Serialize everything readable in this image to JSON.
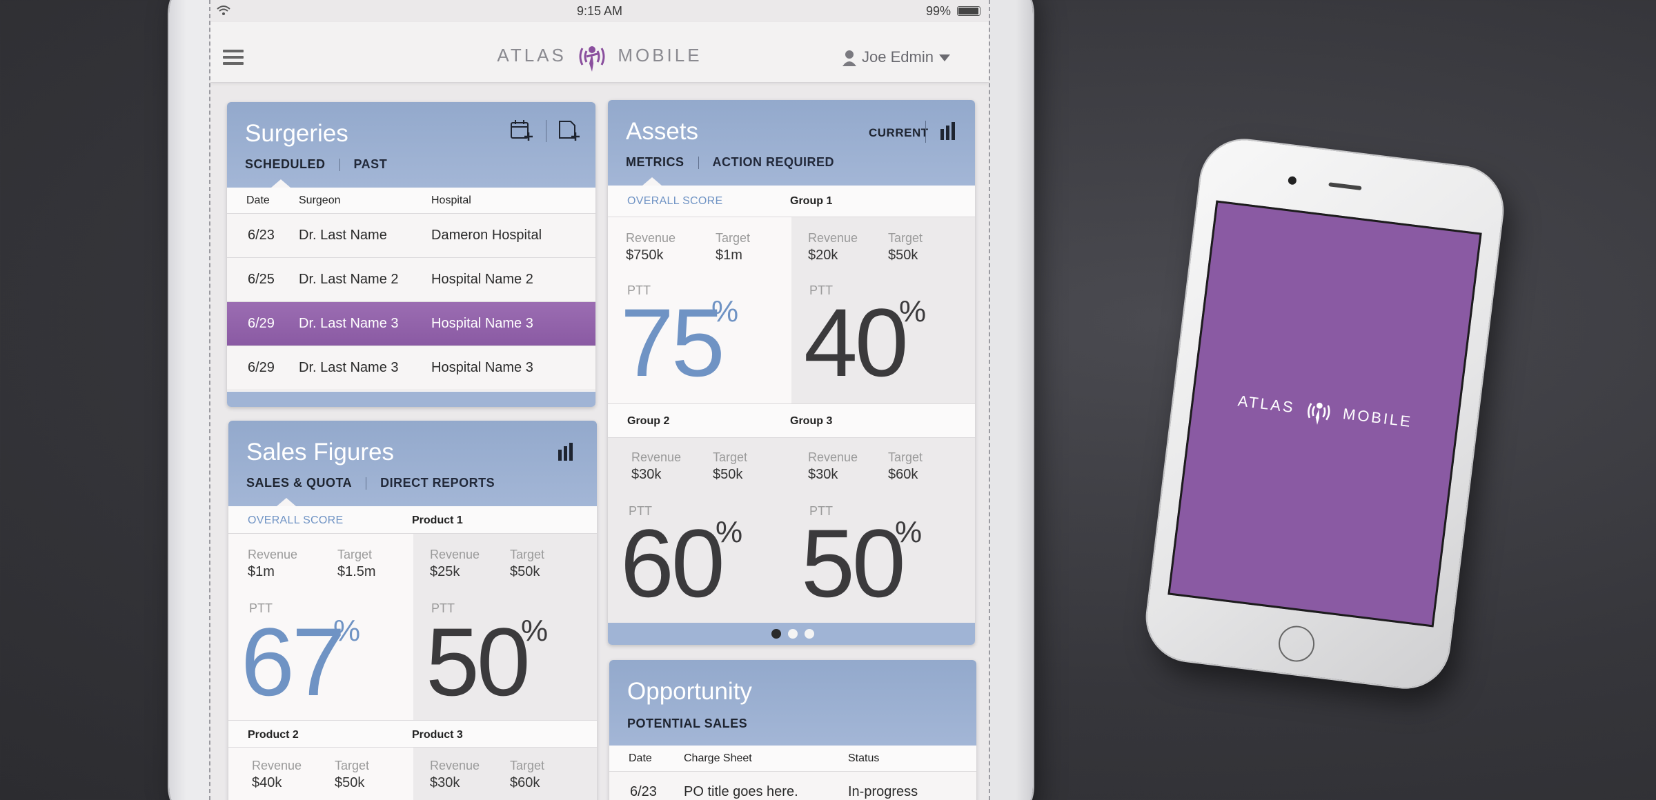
{
  "status_bar": {
    "time": "9:15 AM",
    "battery": "99%"
  },
  "app": {
    "logo_left": "ATLAS",
    "logo_right": "MOBILE",
    "user_name": "Joe Edmin"
  },
  "surgeries": {
    "title": "Surgeries",
    "tabs": [
      "SCHEDULED",
      "PAST"
    ],
    "columns": [
      "Date",
      "Surgeon",
      "Hospital"
    ],
    "rows": [
      {
        "date": "6/23",
        "surgeon": "Dr. Last Name",
        "hospital": "Dameron Hospital",
        "selected": false
      },
      {
        "date": "6/25",
        "surgeon": "Dr. Last Name 2",
        "hospital": "Hospital Name 2",
        "selected": false
      },
      {
        "date": "6/29",
        "surgeon": "Dr. Last Name 3",
        "hospital": "Hospital Name 3",
        "selected": true
      },
      {
        "date": "6/29",
        "surgeon": "Dr. Last Name 3",
        "hospital": "Hospital Name 3",
        "selected": false
      }
    ],
    "selected_color": "#8a5aa3"
  },
  "sales": {
    "title": "Sales Figures",
    "tabs": [
      "SALES & QUOTA",
      "DIRECT REPORTS"
    ],
    "group_a": "OVERALL SCORE",
    "group_b": "Product 1",
    "group_c": "Product 2",
    "group_d": "Product 3",
    "labels": {
      "revenue": "Revenue",
      "target": "Target",
      "ptt": "PTT",
      "percent": "%"
    },
    "overall": {
      "revenue": "$1m",
      "target": "$1.5m",
      "ptt": "67"
    },
    "product1": {
      "revenue": "$25k",
      "target": "$50k",
      "ptt": "50"
    },
    "product2": {
      "revenue": "$40k",
      "target": "$50k"
    },
    "product3": {
      "revenue": "$30k",
      "target": "$60k"
    }
  },
  "assets": {
    "title": "Assets",
    "current_label": "CURRENT",
    "tabs": [
      "METRICS",
      "ACTION REQUIRED"
    ],
    "group_a": "OVERALL SCORE",
    "group_b": "Group 1",
    "group_c": "Group 2",
    "group_d": "Group 3",
    "labels": {
      "revenue": "Revenue",
      "target": "Target",
      "ptt": "PTT",
      "percent": "%"
    },
    "overall": {
      "revenue": "$750k",
      "target": "$1m",
      "ptt": "75"
    },
    "group1": {
      "revenue": "$20k",
      "target": "$50k",
      "ptt": "40"
    },
    "group2": {
      "revenue": "$30k",
      "target": "$50k",
      "ptt": "60"
    },
    "group3": {
      "revenue": "$30k",
      "target": "$60k",
      "ptt": "50"
    },
    "pager": {
      "pages": 3,
      "active": 1
    }
  },
  "opportunity": {
    "title": "Opportunity",
    "tab": "POTENTIAL SALES",
    "columns": [
      "Date",
      "Charge Sheet",
      "Status"
    ],
    "rows": [
      {
        "date": "6/23",
        "charge_sheet": "PO title goes here.",
        "status": "In-progress"
      }
    ]
  },
  "phone": {
    "logo_left": "ATLAS",
    "logo_right": "MOBILE"
  },
  "colors": {
    "header_blue": "#93a9cc",
    "accent_blue": "#6f93c4",
    "purple": "#8a5aa3"
  }
}
